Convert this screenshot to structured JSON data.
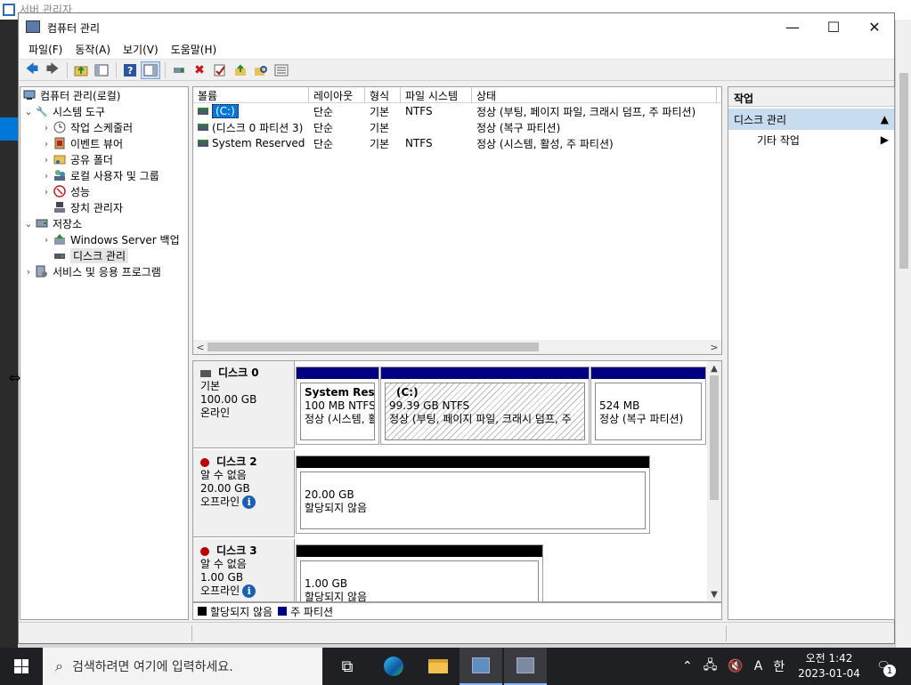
{
  "background": {
    "title": "서버 관리자"
  },
  "window": {
    "title": "컴퓨터 관리",
    "controls": {
      "minimize": "—",
      "maximize": "☐",
      "close": "✕"
    }
  },
  "menu": [
    "파일(F)",
    "동작(A)",
    "보기(V)",
    "도움말(H)"
  ],
  "tree": {
    "root": "컴퓨터 관리(로컬)",
    "system_tools": "시스템 도구",
    "task_scheduler": "작업 스케줄러",
    "event_viewer": "이벤트 뷰어",
    "shared_folders": "공유 폴더",
    "local_users": "로컬 사용자 및 그룹",
    "performance": "성능",
    "device_manager": "장치 관리자",
    "storage": "저장소",
    "windows_backup": "Windows Server 백업",
    "disk_management": "디스크 관리",
    "services_apps": "서비스 및 응용 프로그램"
  },
  "volumes": {
    "columns": [
      "볼륨",
      "레이아웃",
      "형식",
      "파일 시스템",
      "상태"
    ],
    "rows": [
      {
        "name": "(C:)",
        "layout": "단순",
        "type": "기본",
        "fs": "NTFS",
        "status": "정상 (부팅, 페이지 파일, 크래시 덤프, 주 파티션)"
      },
      {
        "name": "(디스크 0 파티션 3)",
        "layout": "단순",
        "type": "기본",
        "fs": "",
        "status": "정상 (복구 파티션)"
      },
      {
        "name": "System Reserved",
        "layout": "단순",
        "type": "기본",
        "fs": "NTFS",
        "status": "정상 (시스템, 활성, 주 파티션)"
      }
    ]
  },
  "disks": {
    "disk0": {
      "name": "디스크 0",
      "kind": "기본",
      "size": "100.00 GB",
      "state": "온라인",
      "partitions": [
        {
          "title": "System Reser",
          "size": "100 MB NTFS",
          "status": "정상 (시스템, 활"
        },
        {
          "title": "(C:)",
          "size": "99.39 GB NTFS",
          "status": "정상 (부팅, 페이지 파일, 크래시 덤프, 주"
        },
        {
          "title": "",
          "size": "524 MB",
          "status": "정상 (복구 파티션)"
        }
      ]
    },
    "disk2": {
      "name": "디스크 2",
      "kind": "알 수 없음",
      "size": "20.00 GB",
      "state": "오프라인",
      "part_size": "20.00 GB",
      "part_status": "할당되지 않음"
    },
    "disk3": {
      "name": "디스크 3",
      "kind": "알 수 없음",
      "size": "1.00 GB",
      "state": "오프라인",
      "part_size": "1.00 GB",
      "part_status": "할당되지 않음"
    }
  },
  "legend": {
    "unallocated": "할당되지 않음",
    "primary": "주 파티션"
  },
  "actions": {
    "header": "작업",
    "section": "디스크 관리",
    "more": "기타 작업"
  },
  "taskbar": {
    "search_placeholder": "검색하려면 여기에 입력하세요.",
    "ime": "A",
    "lang": "한",
    "time": "오전 1:42",
    "date": "2023-01-04",
    "notifications": "1"
  },
  "colors": {
    "primary_partition": "#000080",
    "unallocated": "#000000",
    "selection": "#0078d7",
    "action_section": "#c8dcf0"
  }
}
